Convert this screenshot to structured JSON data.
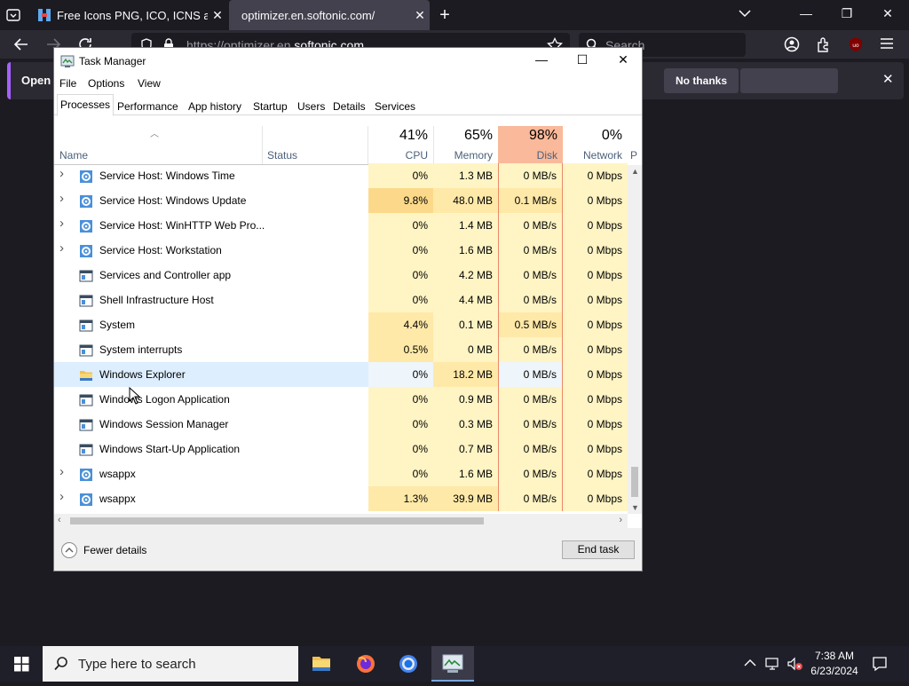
{
  "browser": {
    "tabs": [
      {
        "title": "Free Icons PNG, ICO, ICNS and SVG"
      },
      {
        "title": "optimizer.en.softonic.com/"
      }
    ],
    "url_prefix": "https://optimizer.en.",
    "url_domain": "softonic.com",
    "search_placeholder": "Search",
    "notification": {
      "text": "Open F",
      "no_thanks": "No thanks"
    }
  },
  "taskmanager": {
    "title": "Task Manager",
    "menu": [
      "File",
      "Options",
      "View"
    ],
    "tabs": [
      "Processes",
      "Performance",
      "App history",
      "Startup",
      "Users",
      "Details",
      "Services"
    ],
    "active_tab": "Processes",
    "columns": {
      "name": "Name",
      "status": "Status",
      "cpu": {
        "pct": "41%",
        "label": "CPU"
      },
      "memory": {
        "pct": "65%",
        "label": "Memory"
      },
      "disk": {
        "pct": "98%",
        "label": "Disk"
      },
      "network": {
        "pct": "0%",
        "label": "Network"
      },
      "power_partial": "P"
    },
    "rows": [
      {
        "name": "Service Host: Windows Time",
        "icon": "gear-icon",
        "expandable": true,
        "cpu": "0%",
        "memory": "1.3 MB",
        "disk": "0 MB/s",
        "network": "0 Mbps"
      },
      {
        "name": "Service Host: Windows Update",
        "icon": "gear-icon",
        "expandable": true,
        "cpu": "9.8%",
        "memory": "48.0 MB",
        "disk": "0.1 MB/s",
        "network": "0 Mbps"
      },
      {
        "name": "Service Host: WinHTTP Web Pro...",
        "icon": "gear-icon",
        "expandable": true,
        "cpu": "0%",
        "memory": "1.4 MB",
        "disk": "0 MB/s",
        "network": "0 Mbps"
      },
      {
        "name": "Service Host: Workstation",
        "icon": "gear-icon",
        "expandable": true,
        "cpu": "0%",
        "memory": "1.6 MB",
        "disk": "0 MB/s",
        "network": "0 Mbps"
      },
      {
        "name": "Services and Controller app",
        "icon": "app-window-icon",
        "expandable": false,
        "cpu": "0%",
        "memory": "4.2 MB",
        "disk": "0 MB/s",
        "network": "0 Mbps"
      },
      {
        "name": "Shell Infrastructure Host",
        "icon": "app-window-icon",
        "expandable": false,
        "cpu": "0%",
        "memory": "4.4 MB",
        "disk": "0 MB/s",
        "network": "0 Mbps"
      },
      {
        "name": "System",
        "icon": "app-window-icon",
        "expandable": false,
        "cpu": "4.4%",
        "memory": "0.1 MB",
        "disk": "0.5 MB/s",
        "network": "0 Mbps"
      },
      {
        "name": "System interrupts",
        "icon": "app-window-icon",
        "expandable": false,
        "cpu": "0.5%",
        "memory": "0 MB",
        "disk": "0 MB/s",
        "network": "0 Mbps"
      },
      {
        "name": "Windows Explorer",
        "icon": "folder-icon",
        "expandable": false,
        "selected": true,
        "cpu": "0%",
        "memory": "18.2 MB",
        "disk": "0 MB/s",
        "network": "0 Mbps"
      },
      {
        "name": "Windows Logon Application",
        "icon": "app-window-icon",
        "expandable": false,
        "cpu": "0%",
        "memory": "0.9 MB",
        "disk": "0 MB/s",
        "network": "0 Mbps"
      },
      {
        "name": "Windows Session Manager",
        "icon": "app-window-icon",
        "expandable": false,
        "cpu": "0%",
        "memory": "0.3 MB",
        "disk": "0 MB/s",
        "network": "0 Mbps"
      },
      {
        "name": "Windows Start-Up Application",
        "icon": "app-window-icon",
        "expandable": false,
        "cpu": "0%",
        "memory": "0.7 MB",
        "disk": "0 MB/s",
        "network": "0 Mbps"
      },
      {
        "name": "wsappx",
        "icon": "gear-icon",
        "expandable": true,
        "cpu": "0%",
        "memory": "1.6 MB",
        "disk": "0 MB/s",
        "network": "0 Mbps"
      },
      {
        "name": "wsappx",
        "icon": "gear-icon",
        "expandable": true,
        "cpu": "1.3%",
        "memory": "39.9 MB",
        "disk": "0 MB/s",
        "network": "0 Mbps"
      }
    ],
    "fewer_details": "Fewer details",
    "end_task": "End task"
  },
  "taskbar": {
    "search_placeholder": "Type here to search",
    "apps": [
      "file-explorer-icon",
      "firefox-icon",
      "chrome-icon",
      "task-manager-icon"
    ],
    "time": "7:38 AM",
    "date": "6/23/2024"
  },
  "colors": {
    "heat_low": "#fff4c4",
    "heat_mid": "#ffe9a8",
    "heat_high": "#fcd98a",
    "disk_header": "#f9b99a",
    "selection": "#ddeeff"
  }
}
